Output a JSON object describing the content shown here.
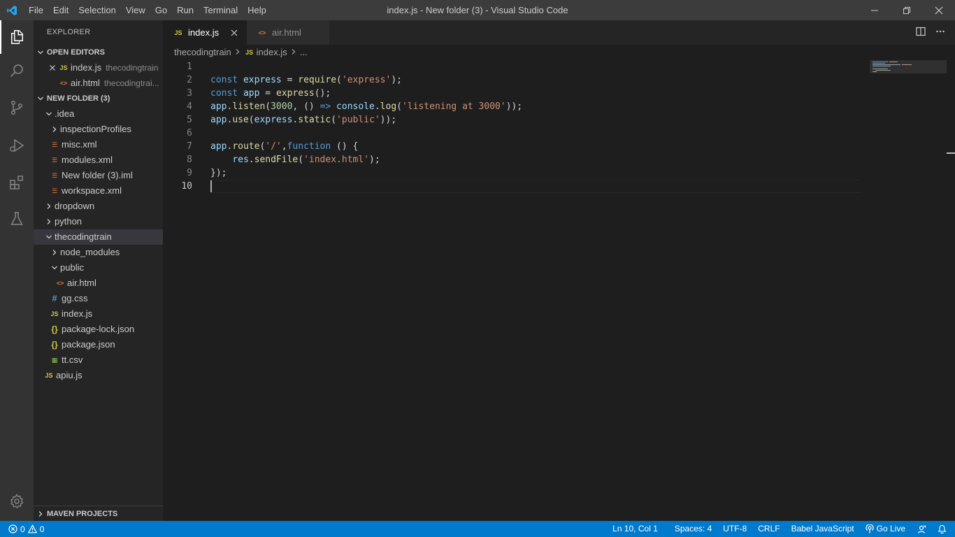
{
  "titlebar": {
    "menu": [
      "File",
      "Edit",
      "Selection",
      "View",
      "Go",
      "Run",
      "Terminal",
      "Help"
    ],
    "title": "index.js - New folder (3) - Visual Studio Code"
  },
  "sidebar": {
    "title": "EXPLORER",
    "open_editors": {
      "header": "OPEN EDITORS",
      "items": [
        {
          "icon": "JS",
          "name": "index.js",
          "desc": "thecodingtrain"
        },
        {
          "icon": "<>",
          "name": "air.html",
          "desc": "thecodingtrai..."
        }
      ]
    },
    "folder": {
      "header": "NEW FOLDER (3)",
      "items": [
        {
          "label": ".idea"
        },
        {
          "label": "inspectionProfiles"
        },
        {
          "label": "misc.xml",
          "icon": "☰"
        },
        {
          "label": "modules.xml",
          "icon": "☰"
        },
        {
          "label": "New folder (3).iml",
          "icon": "☰"
        },
        {
          "label": "workspace.xml",
          "icon": "☰"
        },
        {
          "label": "dropdown"
        },
        {
          "label": "python"
        },
        {
          "label": "thecodingtrain"
        },
        {
          "label": "node_modules"
        },
        {
          "label": "public"
        },
        {
          "label": "air.html",
          "icon": "<>"
        },
        {
          "label": "gg.css",
          "icon": "#"
        },
        {
          "label": "index.js",
          "icon": "JS"
        },
        {
          "label": "package-lock.json",
          "icon": "{}"
        },
        {
          "label": "package.json",
          "icon": "{}"
        },
        {
          "label": "tt.csv",
          "icon": "▦"
        },
        {
          "label": "apiu.js",
          "icon": "JS"
        }
      ]
    },
    "maven": "MAVEN PROJECTS"
  },
  "tabs": [
    {
      "icon": "JS",
      "label": "index.js"
    },
    {
      "icon": "<>",
      "label": "air.html"
    }
  ],
  "breadcrumb": {
    "folder": "thecodingtrain",
    "file_icon": "JS",
    "file": "index.js",
    "more": "..."
  },
  "code": {
    "line_numbers": [
      "1",
      "2",
      "3",
      "4",
      "5",
      "6",
      "7",
      "8",
      "9",
      "10"
    ],
    "lines": [
      [],
      [
        [
          "k",
          "const "
        ],
        [
          "v",
          "express"
        ],
        [
          "p",
          " = "
        ],
        [
          "f",
          "require"
        ],
        [
          "p",
          "("
        ],
        [
          "s",
          "'express'"
        ],
        [
          "p",
          ");"
        ]
      ],
      [
        [
          "k",
          "const "
        ],
        [
          "v",
          "app"
        ],
        [
          "p",
          " = "
        ],
        [
          "f",
          "express"
        ],
        [
          "p",
          "();"
        ]
      ],
      [
        [
          "v",
          "app"
        ],
        [
          "p",
          "."
        ],
        [
          "f",
          "listen"
        ],
        [
          "p",
          "("
        ],
        [
          "n",
          "3000"
        ],
        [
          "p",
          ", () "
        ],
        [
          "k",
          "=>"
        ],
        [
          "p",
          " "
        ],
        [
          "v",
          "console"
        ],
        [
          "p",
          "."
        ],
        [
          "f",
          "log"
        ],
        [
          "p",
          "("
        ],
        [
          "s",
          "'listening at 3000'"
        ],
        [
          "p",
          "));"
        ]
      ],
      [
        [
          "v",
          "app"
        ],
        [
          "p",
          "."
        ],
        [
          "f",
          "use"
        ],
        [
          "p",
          "("
        ],
        [
          "v",
          "express"
        ],
        [
          "p",
          "."
        ],
        [
          "f",
          "static"
        ],
        [
          "p",
          "("
        ],
        [
          "s",
          "'public'"
        ],
        [
          "p",
          "));"
        ]
      ],
      [],
      [
        [
          "v",
          "app"
        ],
        [
          "p",
          "."
        ],
        [
          "f",
          "route"
        ],
        [
          "p",
          "("
        ],
        [
          "s",
          "'/'"
        ],
        [
          "p",
          ","
        ],
        [
          "k",
          "function"
        ],
        [
          "p",
          " () {"
        ]
      ],
      [
        [
          "p",
          "    "
        ],
        [
          "v",
          "res"
        ],
        [
          "p",
          "."
        ],
        [
          "f",
          "sendFile"
        ],
        [
          "p",
          "("
        ],
        [
          "s",
          "'index.html'"
        ],
        [
          "p",
          ");"
        ]
      ],
      [
        [
          "p",
          "});"
        ]
      ],
      []
    ]
  },
  "statusbar": {
    "errors": "0",
    "warnings": "0",
    "position": "Ln 10, Col 1",
    "spaces": "Spaces: 4",
    "encoding": "UTF-8",
    "eol": "CRLF",
    "language": "Babel JavaScript",
    "golive": "Go Live"
  }
}
